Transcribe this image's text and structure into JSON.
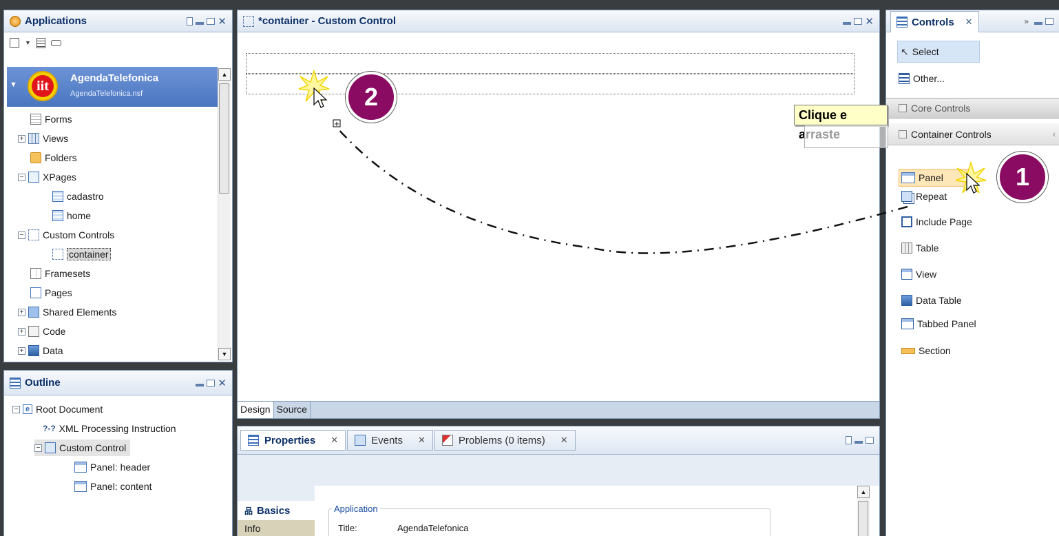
{
  "apps": {
    "title": "Applications",
    "app_name": "AgendaTelefonica",
    "app_file": "AgendaTelefonica.nsf",
    "tree": [
      {
        "label": "Forms"
      },
      {
        "label": "Views"
      },
      {
        "label": "Folders"
      },
      {
        "label": "XPages"
      },
      {
        "label": "cadastro"
      },
      {
        "label": "home"
      },
      {
        "label": "Custom Controls"
      },
      {
        "label": "container"
      },
      {
        "label": "Framesets"
      },
      {
        "label": "Pages"
      },
      {
        "label": "Shared Elements"
      },
      {
        "label": "Code"
      },
      {
        "label": "Data"
      }
    ]
  },
  "outline": {
    "title": "Outline",
    "items": [
      {
        "label": "Root Document"
      },
      {
        "label": "XML Processing Instruction"
      },
      {
        "label": "Custom Control"
      },
      {
        "label": "Panel: header"
      },
      {
        "label": "Panel: content"
      }
    ]
  },
  "editor": {
    "title": "*container - Custom Control",
    "tabs": [
      "Design",
      "Source"
    ]
  },
  "bottom": {
    "tabs": [
      "Properties",
      "Events",
      "Problems (0 items)"
    ],
    "side_tabs": [
      "Basics",
      "Info"
    ],
    "group_label": "Application",
    "field_label": "Title:",
    "field_value": "AgendaTelefonica"
  },
  "controls": {
    "title": "Controls",
    "select": "Select",
    "other": "Other...",
    "core": "Core Controls",
    "container": "Container Controls",
    "items": [
      "Panel",
      "Repeat",
      "Include Page",
      "Table",
      "View",
      "Data Table",
      "Tabbed Panel",
      "Section"
    ]
  },
  "annotations": {
    "tooltip": "Clique e arraste",
    "step1": "1",
    "step2": "2"
  },
  "colors": {
    "step_badge": "#8a0b62",
    "tooltip_bg": "#ffffc8",
    "selection": "#4a76c0"
  }
}
